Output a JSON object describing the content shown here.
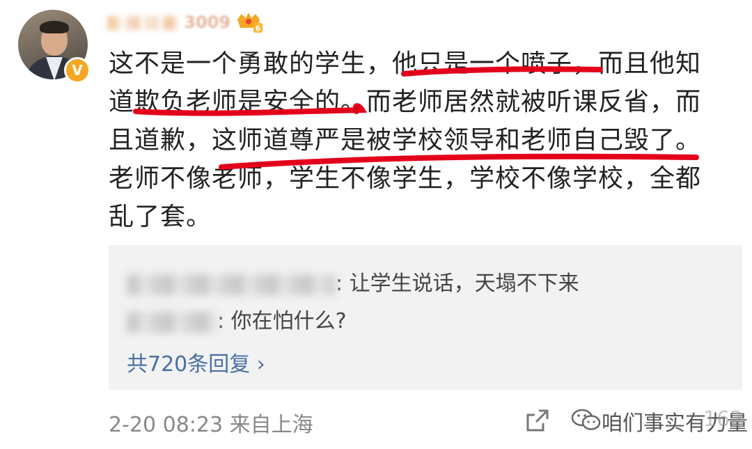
{
  "comment": {
    "username_tail": "3009",
    "level_badge": "6",
    "verified_badge": "V",
    "text_lines": [
      "这不是一个勇敢的学生，他只是一个喷子，而且他知",
      "道欺负老师是安全的。而老师居然就被听课反省，而",
      "且道歉，这师道尊严是被学校领导和老师自己毁了。",
      "老师不像老师，学生不像学生，学校不像学校，全都",
      "乱了套。"
    ],
    "annotation_color": "#e3001b"
  },
  "replies": [
    {
      "text": ": 让学生说话，天塌不下来"
    },
    {
      "text": ": 你在怕什么?"
    }
  ],
  "more_replies": "共720条回复 ›",
  "footer": {
    "time_location": "2-20 08:23  来自上海",
    "watermark": "咱们事实有力量",
    "like_count": "162"
  }
}
